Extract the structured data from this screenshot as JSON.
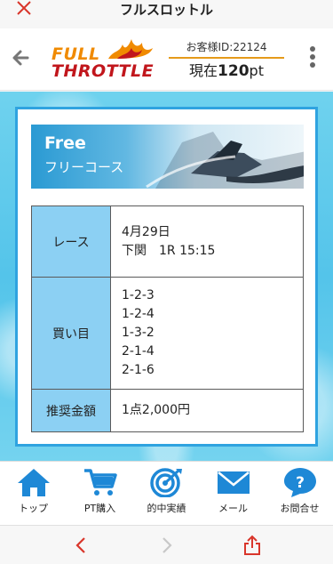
{
  "window": {
    "title": "フルスロットル",
    "close_icon": "close-x-icon"
  },
  "header": {
    "back_icon": "arrow-left-icon",
    "logo": {
      "line1": "FULL",
      "line2": "THROTTLE"
    },
    "account_id": "お客様ID:22124",
    "points_prefix": "現在",
    "points_value": "120",
    "points_unit": "pt",
    "menu_icon": "kebab-menu-icon"
  },
  "banner": {
    "title": "Free",
    "subtitle": "フリーコース"
  },
  "race_table": {
    "rows": [
      {
        "header": "レース",
        "lines": [
          "4月29日",
          "下関　1R 15:15"
        ]
      },
      {
        "header": "買い目",
        "lines": [
          "1-2-3",
          "1-2-4",
          "1-3-2",
          "2-1-4",
          "2-1-6"
        ]
      },
      {
        "header": "推奨金額",
        "lines": [
          "1点2,000円"
        ]
      }
    ]
  },
  "tabbar": {
    "items": [
      {
        "label": "トップ",
        "icon": "home-icon"
      },
      {
        "label": "PT購入",
        "icon": "cart-icon"
      },
      {
        "label": "的中実績",
        "icon": "target-icon"
      },
      {
        "label": "メール",
        "icon": "mail-icon"
      },
      {
        "label": "お問合せ",
        "icon": "help-icon"
      }
    ]
  },
  "browser_nav": {
    "back_icon": "chevron-left-icon",
    "forward_icon": "chevron-right-icon",
    "share_icon": "share-icon"
  },
  "colors": {
    "accent_blue": "#2fa3e0",
    "tab_blue": "#1e88d6",
    "header_orange": "#e59a1a",
    "nav_red": "#d9362b",
    "table_header": "#8cd0f3"
  }
}
